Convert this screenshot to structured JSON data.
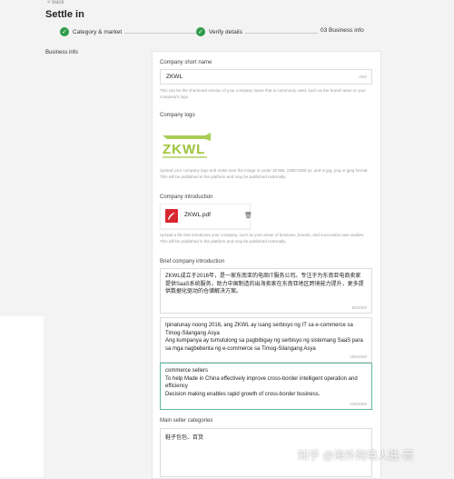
{
  "nav": {
    "back_label": "< Back"
  },
  "page": {
    "title": "Settle in",
    "section_label": "Business info"
  },
  "steps": [
    {
      "label": "Category & market",
      "state": "done"
    },
    {
      "label": "Verify details",
      "state": "done"
    },
    {
      "label": "03 Business info",
      "state": "current"
    }
  ],
  "form": {
    "company_short_name": {
      "label": "Company short name",
      "value": "ZKWL",
      "counter": "4/50",
      "help": "This can be the shortened version of your company name that is commonly used, such as the brand name or your company's logo."
    },
    "company_logo": {
      "label": "Company logo",
      "logo_text": "ZKWL",
      "help": "Upload your company logo and make sure the image is under 30 MB, 1080*1080 px, and in jpg, png or jpeg format. This will be published in the platform and may be published externally."
    },
    "company_introduction": {
      "label": "Company introduction",
      "file_name": "ZKWL.pdf",
      "help": "Upload a file that introduces your company, such as your areas of business, brands, and successful case studies. This will be published in the platform and may be published externally."
    },
    "brief_intro": {
      "label": "Brief company introduction",
      "chinese_text": "ZKWL成立于2016年，是一家东南亚的电商IT服务公司。专注于为东南亚电商卖家提供SaaS系统服务，助力中国制造的出海卖家在东南亚地区跨境能力提升，更多提供数据化驱动的仓储解决方案。",
      "chinese_counter": "85/2000",
      "filipino_text": "Ipinatunay noong 2016, ang ZKWL ay isang serbisyo ng IT sa e-commerce sa Timog-Silangang Asya\nAng kumpanya ay tumutulong sa pagbibigay ng serbisyo ng sistemang SaaS para sa mga nagbebenta ng e-commerce sa Timog-Silangang Asya",
      "filipino_counter": "269/2000",
      "english_text": "commerce sellers\nTo help Made in China effectively improve cross-border intelligent operation and efficiency\nDecision making enables rapid growth of cross-border business.",
      "english_counter": "235/2000"
    },
    "main_seller_categories": {
      "label": "Main seller categories",
      "value": "鞋子包包、百货"
    }
  },
  "watermark": "知乎 @海外跨境人驻-晋",
  "colors": {
    "accent_green": "#2e9b4a",
    "pdf_red": "#d9262f",
    "logo_green": "#9cc43a",
    "active_border": "#5fb7a4"
  }
}
